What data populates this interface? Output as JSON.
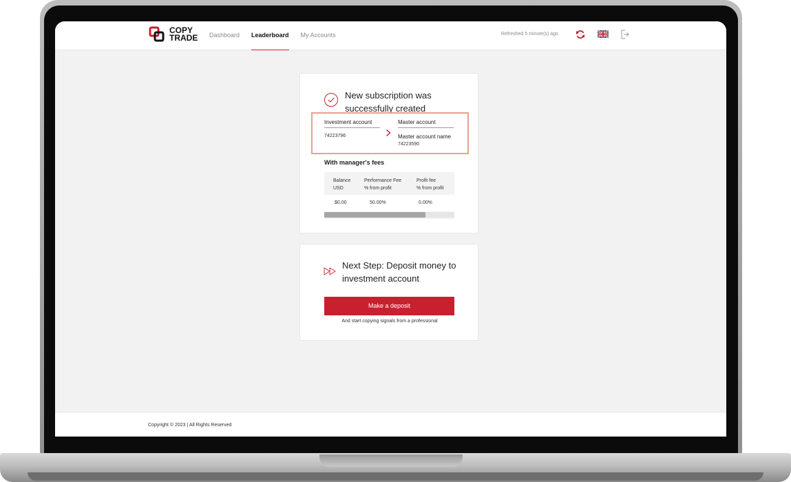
{
  "header": {
    "logo": {
      "line1": "COPY",
      "line2": "TRADE"
    },
    "nav": [
      {
        "label": "Dashboard",
        "active": false
      },
      {
        "label": "Leaderboard",
        "active": true
      },
      {
        "label": "My Accounts",
        "active": false
      }
    ],
    "refreshed_text": "Refreshed 5 minute(s) ago",
    "icons": {
      "refresh": "refresh-icon",
      "language": "uk-flag-icon",
      "logout": "logout-icon"
    }
  },
  "subscription_card": {
    "title": "New subscription was successfully created",
    "investment": {
      "label": "Investment account",
      "value": "74223796"
    },
    "master": {
      "label": "Master account",
      "name": "Master account name",
      "value": "74223590"
    },
    "fees_title": "With manager's fees",
    "fees_table": {
      "headers": [
        {
          "line1": "Balance",
          "line2": "USD"
        },
        {
          "line1": "Performance Fee",
          "line2": "% from profit"
        },
        {
          "line1": "Profit fee",
          "line2": "% from profit"
        }
      ],
      "row": [
        "$0.00",
        "50.00%",
        "0.00%"
      ],
      "scroll_fraction": 0.78
    }
  },
  "next_step_card": {
    "title": "Next Step: Deposit money to investment account",
    "button_label": "Make a deposit",
    "subtitle": "And start copying signals from a professional"
  },
  "footer": {
    "copyright": "Copyright © 2023 | All Rights Reserved"
  },
  "colors": {
    "accent": "#c8202f",
    "highlight_border": "#e9a08e",
    "background": "#f2f2f2"
  }
}
